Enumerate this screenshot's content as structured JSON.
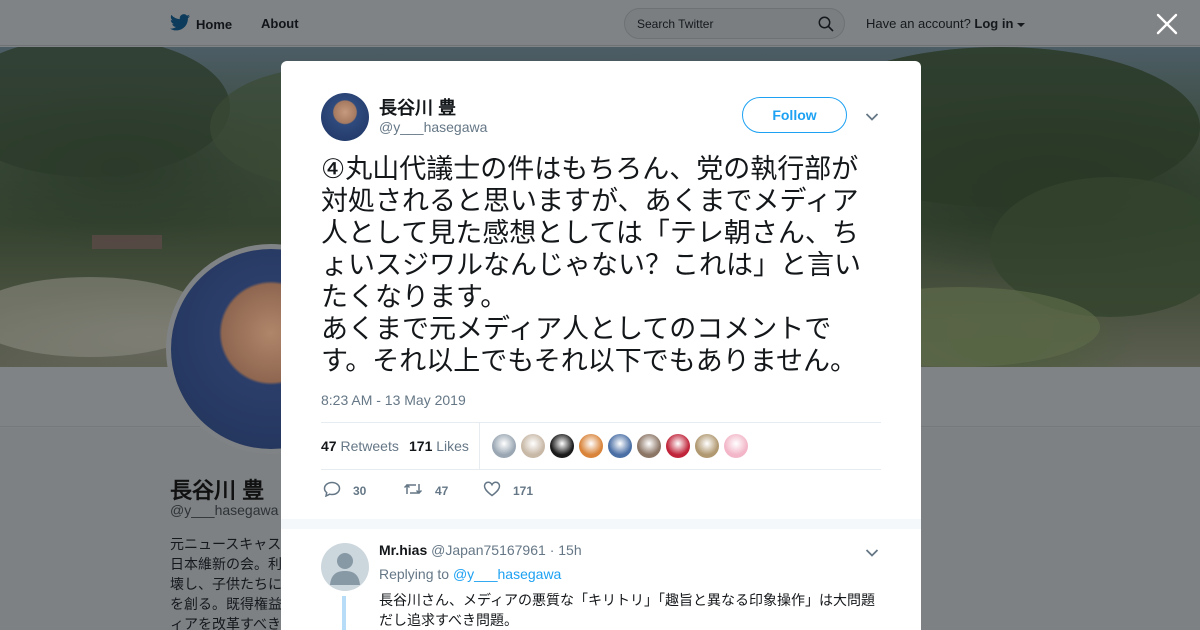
{
  "nav": {
    "home_label": "Home",
    "about_label": "About",
    "search_placeholder": "Search Twitter",
    "account_prompt": "Have an account?",
    "login_label": "Log in"
  },
  "background_profile": {
    "name": "長谷川 豊",
    "handle": "@y___hasegawa",
    "bio_lines": [
      "元ニュースキャス",
      "日本維新の会。利",
      "壊し、子供たちに",
      "を創る。既得権益",
      "ィアを改革すべき"
    ]
  },
  "tweet": {
    "author_name": "長谷川 豊",
    "author_handle": "@y___hasegawa",
    "follow_label": "Follow",
    "text": "④丸山代議士の件はもちろん、党の執行部が対処されると思いますが、あくまでメディア人として見た感想としては「テレ朝さん、ちょいスジワルなんじゃない？これは」と言いたくなります。\nあくまで元メディア人としてのコメントです。それ以上でもそれ以下でもありません。",
    "timestamp": "8:23 AM - 13 May 2019",
    "retweets_count": "47",
    "retweets_label": "Retweets",
    "likes_count": "171",
    "likes_label": "Likes",
    "actions": {
      "reply_count": "30",
      "retweet_count": "47",
      "like_count": "171"
    },
    "liker_colors": [
      "#9aa7b3",
      "#c8b8a6",
      "#1b1b1b",
      "#d9843a",
      "#4a6fa5",
      "#8b7565",
      "#c0243a",
      "#b09870",
      "#f2b6c8"
    ]
  },
  "reply": {
    "name": "Mr.hias",
    "handle": "@Japan75167961",
    "separator": "·",
    "time": "15h",
    "replying_to_label": "Replying to",
    "replying_to_handle": "@y___hasegawa",
    "text": "長谷川さん、メディアの悪質な「キリトリ」「趣旨と異なる印象操作」は大問題だし追求すべき問題。"
  },
  "colors": {
    "accent": "#1da1f2",
    "muted": "#657786"
  }
}
